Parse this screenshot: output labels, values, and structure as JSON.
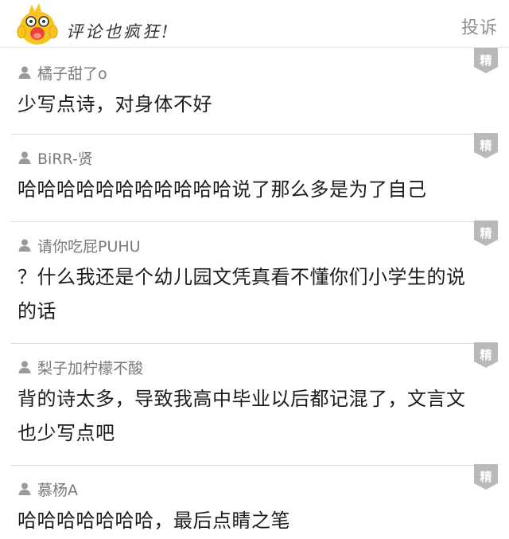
{
  "header": {
    "title": "评论也疯狂!",
    "report_label": "投诉"
  },
  "badge_label": "精",
  "comments": [
    {
      "author": "橘子甜了o",
      "text": "少写点诗，对身体不好"
    },
    {
      "author": "BiRR-贤",
      "text": "哈哈哈哈哈哈哈哈哈哈哈说了那么多是为了自己"
    },
    {
      "author": "请你吃屁PUHU",
      "text": "？什么我还是个幼儿园文凭真看不懂你们小学生的说的话"
    },
    {
      "author": "梨子加柠檬不酸",
      "text": "背的诗太多，导致我高中毕业以后都记混了，文言文也少写点吧"
    },
    {
      "author": "慕杨A",
      "text": "哈哈哈哈哈哈哈，最后点睛之笔"
    }
  ],
  "colors": {
    "badge": "#b9b9b9",
    "author": "#7a7a7a",
    "report": "#8f8f8f",
    "divider": "#d9d9d9",
    "mascot": "#f7c51e"
  }
}
